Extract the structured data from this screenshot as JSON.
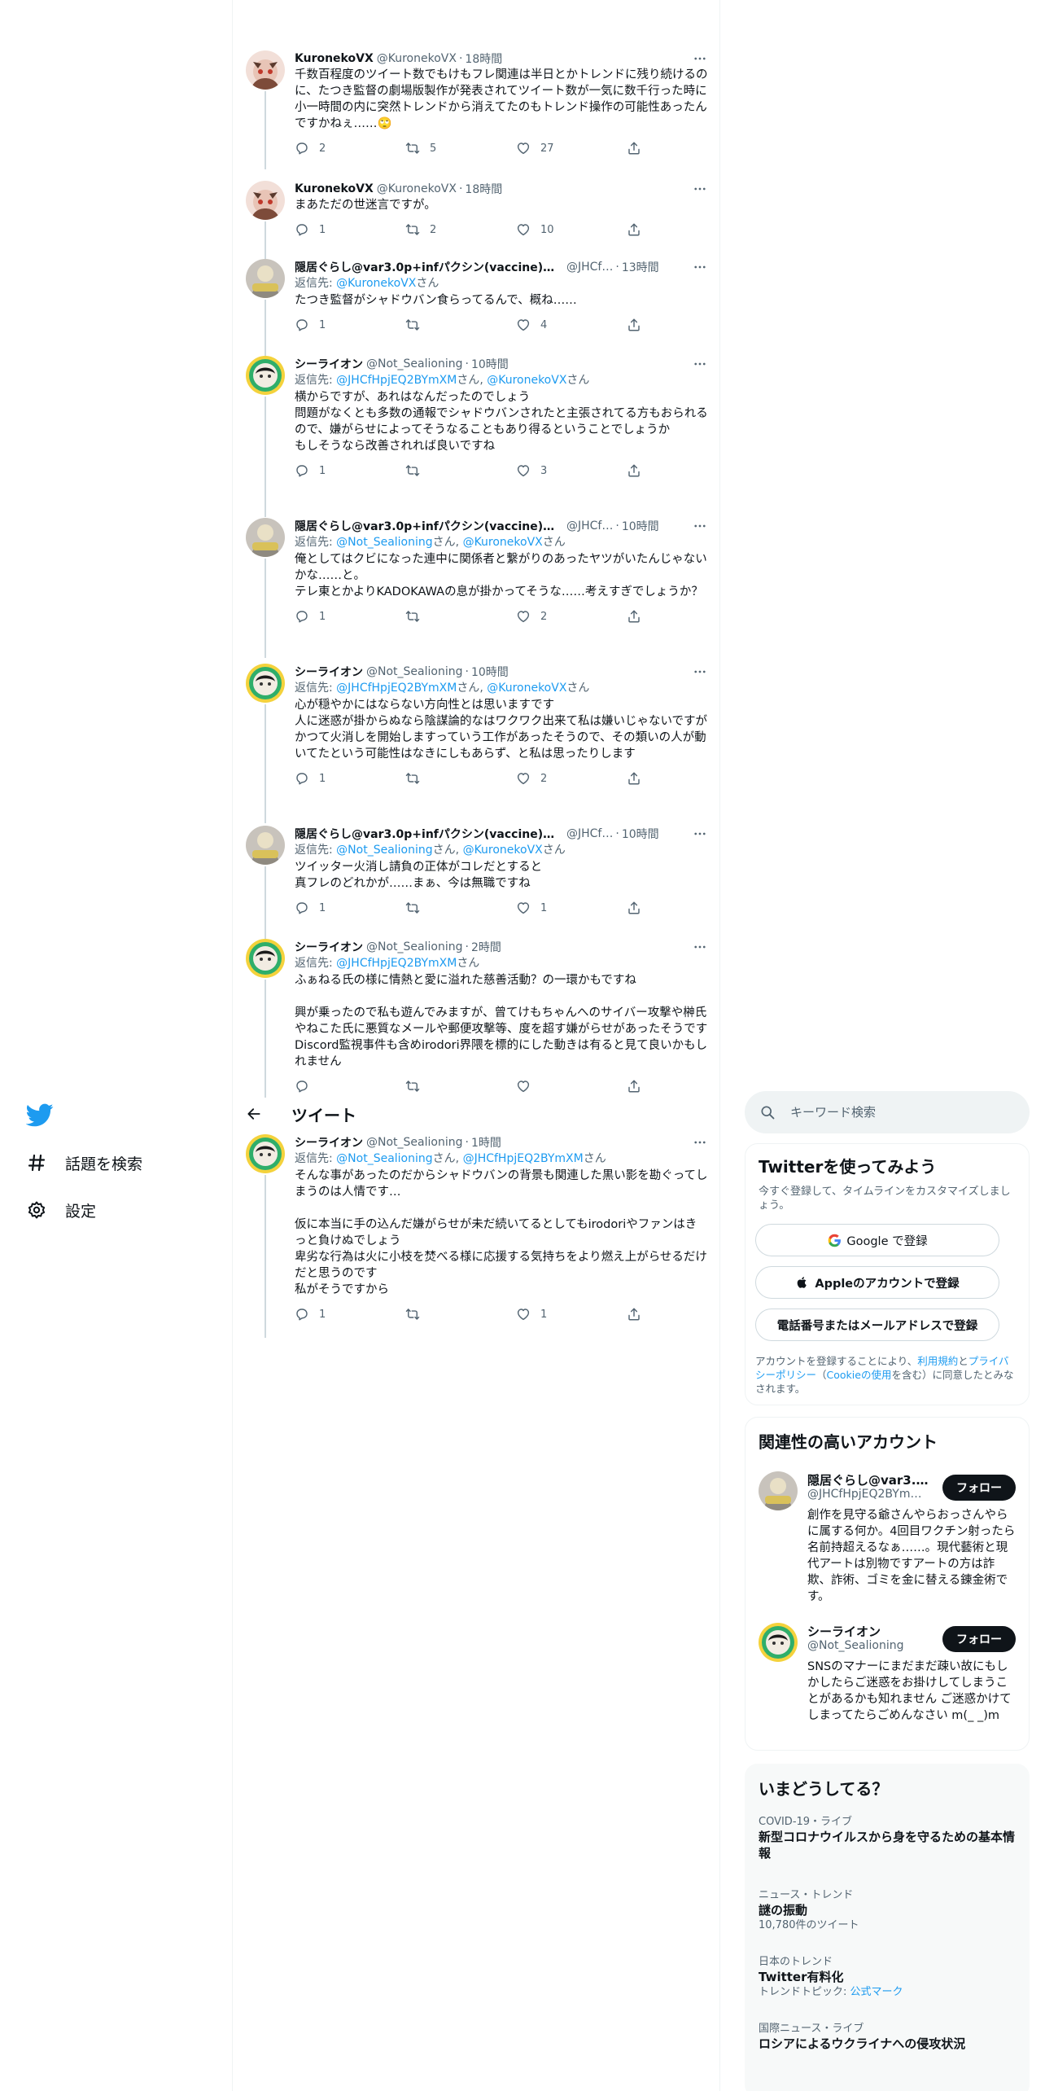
{
  "nav": {
    "items": [
      {
        "label": "話題を検索",
        "icon": "hashtag-icon"
      },
      {
        "label": "設定",
        "icon": "gear-icon"
      }
    ]
  },
  "header": {
    "title": "ツイート"
  },
  "tweets": [
    {
      "name": "KuronekoVX",
      "handle": "@KuronekoVX",
      "time": "18時間",
      "reply_to_prefix": "",
      "reply_mentions": [],
      "text": "千数百程度のツイート数でもけもフレ関連は半日とかトレンドに残り続けるのに、たつき監督の劇場版製作が発表されてツイート数が一気に数千行った時に小一時間の内に突然トレンドから消えてたのもトレンド操作の可能性あったんですかねぇ……🙄",
      "replies": "2",
      "retweets": "5",
      "likes": "27"
    },
    {
      "name": "KuronekoVX",
      "handle": "@KuronekoVX",
      "time": "18時間",
      "reply_to_prefix": "",
      "reply_mentions": [],
      "text": "まあただの世迷言ですが。",
      "replies": "1",
      "retweets": "2",
      "likes": "10"
    },
    {
      "name": "隠居ぐらし@var3.0p+infパクシン(vaccine)教徒…",
      "handle": "@JHCf…",
      "time": "13時間",
      "reply_to_prefix": "返信先: ",
      "reply_mentions": [
        "@KuronekoVX"
      ],
      "reply_suffix": "さん",
      "text": "たつき監督がシャドウバン食らってるんで、概ね……",
      "replies": "1",
      "retweets": "",
      "likes": "4"
    },
    {
      "name": "シーライオン",
      "handle": "@Not_Sealioning",
      "time": "10時間",
      "reply_to_prefix": "返信先: ",
      "reply_mentions": [
        "@JHCfHpjEQ2BYmXM",
        "@KuronekoVX"
      ],
      "reply_suffix": "さん",
      "text": "横からですが、あれはなんだったのでしょう\n問題がなくとも多数の通報でシャドウバンされたと主張されてる方もおられるので、嫌がらせによってそうなることもあり得るということでしょうか\nもしそうなら改善されれば良いですね",
      "replies": "1",
      "retweets": "",
      "likes": "3"
    },
    {
      "name": "隠居ぐらし@var3.0p+infパクシン(vaccine)教徒…",
      "handle": "@JHCf…",
      "time": "10時間",
      "reply_to_prefix": "返信先: ",
      "reply_mentions": [
        "@Not_Sealioning",
        "@KuronekoVX"
      ],
      "reply_suffix": "さん",
      "text": "俺としてはクビになった連中に関係者と繋がりのあったヤツがいたんじゃないかな……と。\nテレ東とかよりKADOKAWAの息が掛かってそうな……考えすぎでしょうか？",
      "replies": "1",
      "retweets": "",
      "likes": "2"
    },
    {
      "name": "シーライオン",
      "handle": "@Not_Sealioning",
      "time": "10時間",
      "reply_to_prefix": "返信先: ",
      "reply_mentions": [
        "@JHCfHpjEQ2BYmXM",
        "@KuronekoVX"
      ],
      "reply_suffix": "さん",
      "text": "心が穏やかにはならない方向性とは思いますです\n人に迷惑が掛からぬなら陰謀論的なはワクワク出来て私は嫌いじゃないですが\nかつて火消しを開始しますっていう工作があったそうので、その類いの人が動いてたという可能性はなきにしもあらず、と私は思ったりします",
      "replies": "1",
      "retweets": "",
      "likes": "2"
    },
    {
      "name": "隠居ぐらし@var3.0p+infパクシン(vaccine)教徒…",
      "handle": "@JHCf…",
      "time": "10時間",
      "reply_to_prefix": "返信先: ",
      "reply_mentions": [
        "@Not_Sealioning",
        "@KuronekoVX"
      ],
      "reply_suffix": "さん",
      "text": "ツイッター火消し請負の正体がコレだとすると\n真フレのどれかが……まぁ、今は無職ですね",
      "replies": "1",
      "retweets": "",
      "likes": "1"
    },
    {
      "name": "シーライオン",
      "handle": "@Not_Sealioning",
      "time": "2時間",
      "reply_to_prefix": "返信先: ",
      "reply_mentions": [
        "@JHCfHpjEQ2BYmXM"
      ],
      "reply_suffix": "さん",
      "text": "ふぁねる氏の様に情熱と愛に溢れた慈善活動？の一環かもですね\n\n興が乗ったので私も遊んでみますが、曾てけもちゃんへのサイバー攻撃や榊氏やねこた氏に悪質なメールや郵便攻撃等、度を超す嫌がらせがあったそうです\nDiscord監視事件も含めirodori界隈を標的にした動きは有ると見て良いかもしれません",
      "replies": "",
      "retweets": "",
      "likes": ""
    },
    {
      "name": "シーライオン",
      "handle": "@Not_Sealioning",
      "time": "1時間",
      "reply_to_prefix": "返信先: ",
      "reply_mentions": [
        "@Not_Sealioning",
        "@JHCfHpjEQ2BYmXM"
      ],
      "reply_suffix": "さん",
      "text": "そんな事があったのだからシャドウバンの背景も関連した黒い影を勘ぐってしまうのは人情です…\n\n仮に本当に手の込んだ嫌がらせが未だ続いてるとしてもirodoriやファンはきっと負けぬでしょう\n卑劣な行為は火に小枝を焚べる様に応援する気持ちをより燃え上がらせるだけだと思うのです\n私がそうですから",
      "replies": "1",
      "retweets": "",
      "likes": "1"
    }
  ],
  "search": {
    "placeholder": "キーワード検索"
  },
  "signup": {
    "title": "Twitterを使ってみよう",
    "subtitle": "今すぐ登録して、タイムラインをカスタマイズしましょう。",
    "google_label": "Google で登録",
    "apple_label": "Appleのアカウントで登録",
    "phone_label": "電話番号またはメールアドレスで登録",
    "legal_prefix": "アカウントを登録することにより、",
    "legal_terms": "利用規約",
    "legal_and": "と",
    "legal_privacy": "プライバシーポリシー",
    "legal_paren_open": "（",
    "legal_cookie": "Cookieの使用",
    "legal_suffix": "を含む）に同意したとみなされます。"
  },
  "related": {
    "title": "関連性の高いアカウント",
    "accounts": [
      {
        "name": "隠居ぐらし@var3.0p…",
        "handle": "@JHCfHpjEQ2BYm…",
        "bio": "創作を見守る爺さんやらおっさんやらに属する何か。4回目ワクチン射ったら名前持超えるなぁ……。現代藝術と現代アートは別物ですアートの方は詐欺、詐術、ゴミを金に替える錬金術です。",
        "follow": "フォロー"
      },
      {
        "name": "シーライオン",
        "handle": "@Not_Sealioning",
        "bio": "SNSのマナーにまだまだ疎い故にもしかしたらご迷惑をお掛けしてしまうことがあるかも知れません ご迷惑かけてしまってたらごめんなさい m(_ _)m",
        "follow": "フォロー"
      }
    ]
  },
  "trends": {
    "title": "いまどうしてる？",
    "items": [
      {
        "category": "COVID-19・ライブ",
        "name": "新型コロナウイルスから身を守るための基本情報",
        "meta": "",
        "meta_link": ""
      },
      {
        "category": "ニュース・トレンド",
        "name": "謎の振動",
        "meta": "10,780件のツイート",
        "meta_link": ""
      },
      {
        "category": "日本のトレンド",
        "name": "Twitter有料化",
        "meta": "トレンドトピック: ",
        "meta_link": "公式マーク"
      },
      {
        "category": "国際ニュース・ライブ",
        "name": "ロシアによるウクライナへの侵攻状況",
        "meta": "",
        "meta_link": ""
      }
    ]
  },
  "colors": {
    "accent": "#1d9bf0",
    "text": "#0f1419",
    "secondary": "#536471",
    "border": "#eff3f4"
  }
}
